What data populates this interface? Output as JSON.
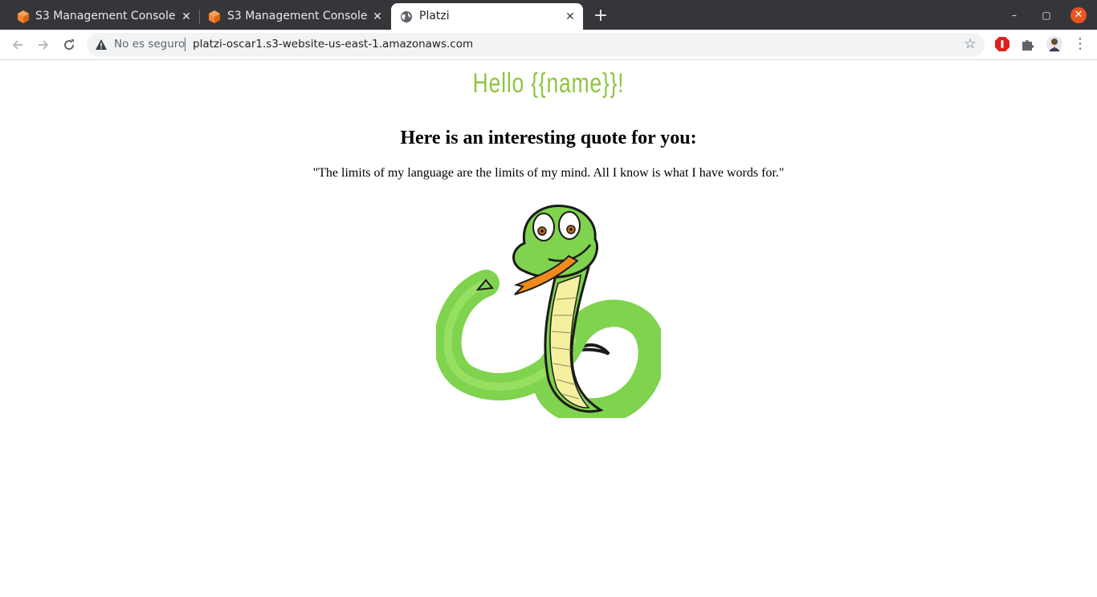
{
  "browser": {
    "tabs": [
      {
        "title": "S3 Management Console",
        "favicon": "aws-s3-icon",
        "active": false
      },
      {
        "title": "S3 Management Console",
        "favicon": "aws-s3-icon",
        "active": false
      },
      {
        "title": "Platzi",
        "favicon": "globe-icon",
        "active": true
      }
    ],
    "close_glyph": "✕",
    "new_tab_glyph": "+",
    "window_controls": {
      "minimize": "–",
      "maximize": "▢",
      "close": "✕"
    },
    "omnibox": {
      "security_label": "No es seguro",
      "url": "platzi-oscar1.s3-website-us-east-1.amazonaws.com"
    },
    "colors": {
      "tabstrip": "#35363a",
      "accent_close": "#e95420"
    }
  },
  "page": {
    "greeting": "Hello {{name}}!",
    "quote_heading": "Here is an interesting quote for you:",
    "quote": "\"The limits of my language are the limits of my mind. All I know is what I have words for.\"",
    "image": "cartoon-snake-image",
    "colors": {
      "greeting": "#8ec63f",
      "snake_body": "#7fd34e",
      "snake_belly": "#f4f0a0"
    }
  }
}
